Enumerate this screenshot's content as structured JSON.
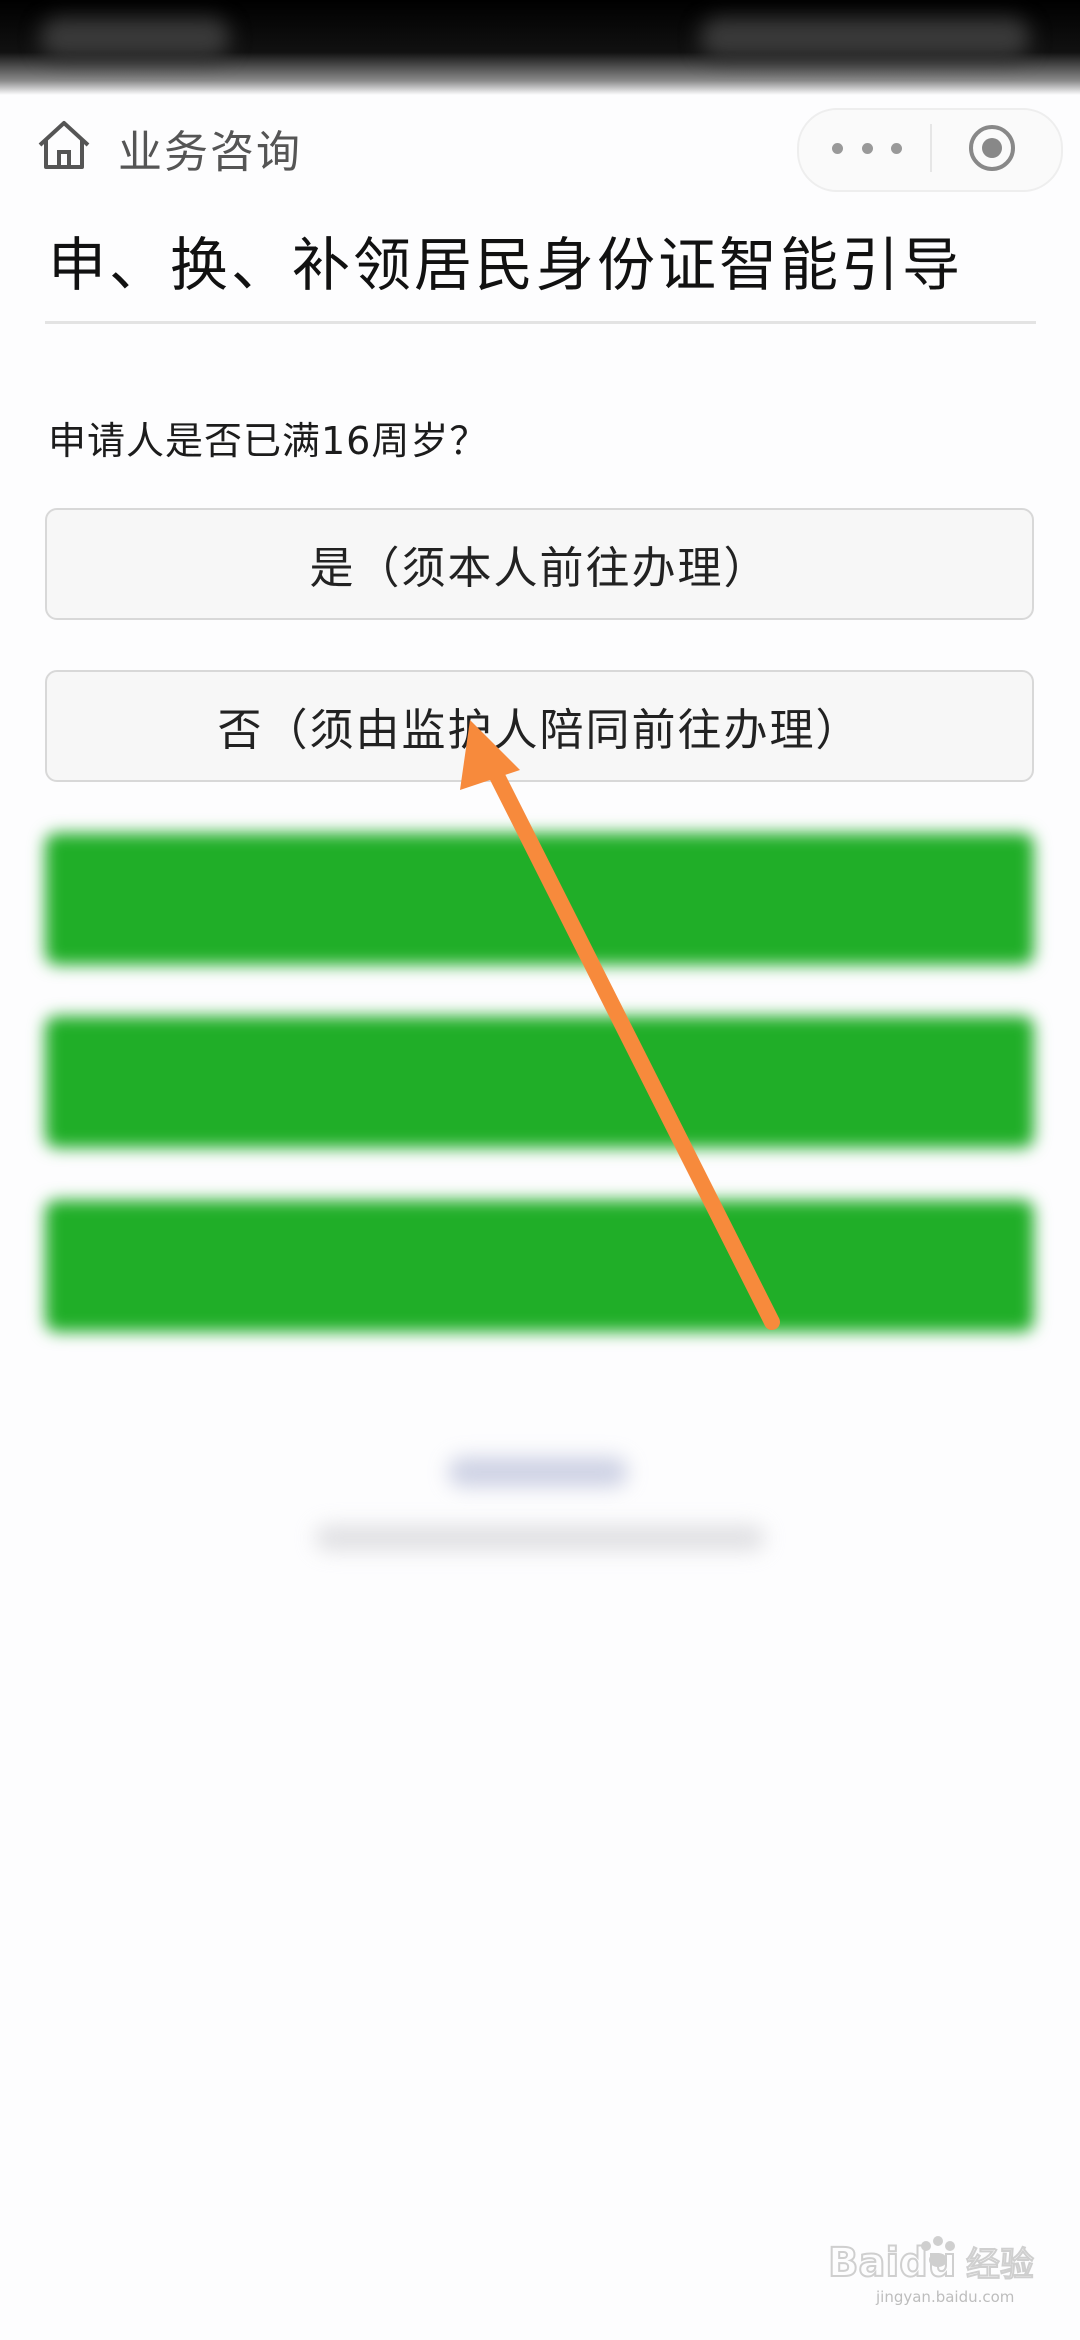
{
  "nav": {
    "title": "业务咨询"
  },
  "page": {
    "title": "申、换、补领居民身份证智能引导",
    "question": "申请人是否已满16周岁？",
    "options": [
      {
        "label": "是（须本人前往办理）"
      },
      {
        "label": "否（须由监护人陪同前往办理）"
      }
    ]
  },
  "watermark": {
    "brand": "Baidu",
    "suffix": "经验",
    "url": "jingyan.baidu.com"
  },
  "colors": {
    "accent_green": "#20ae28",
    "annotation_arrow": "#f78a3c"
  }
}
